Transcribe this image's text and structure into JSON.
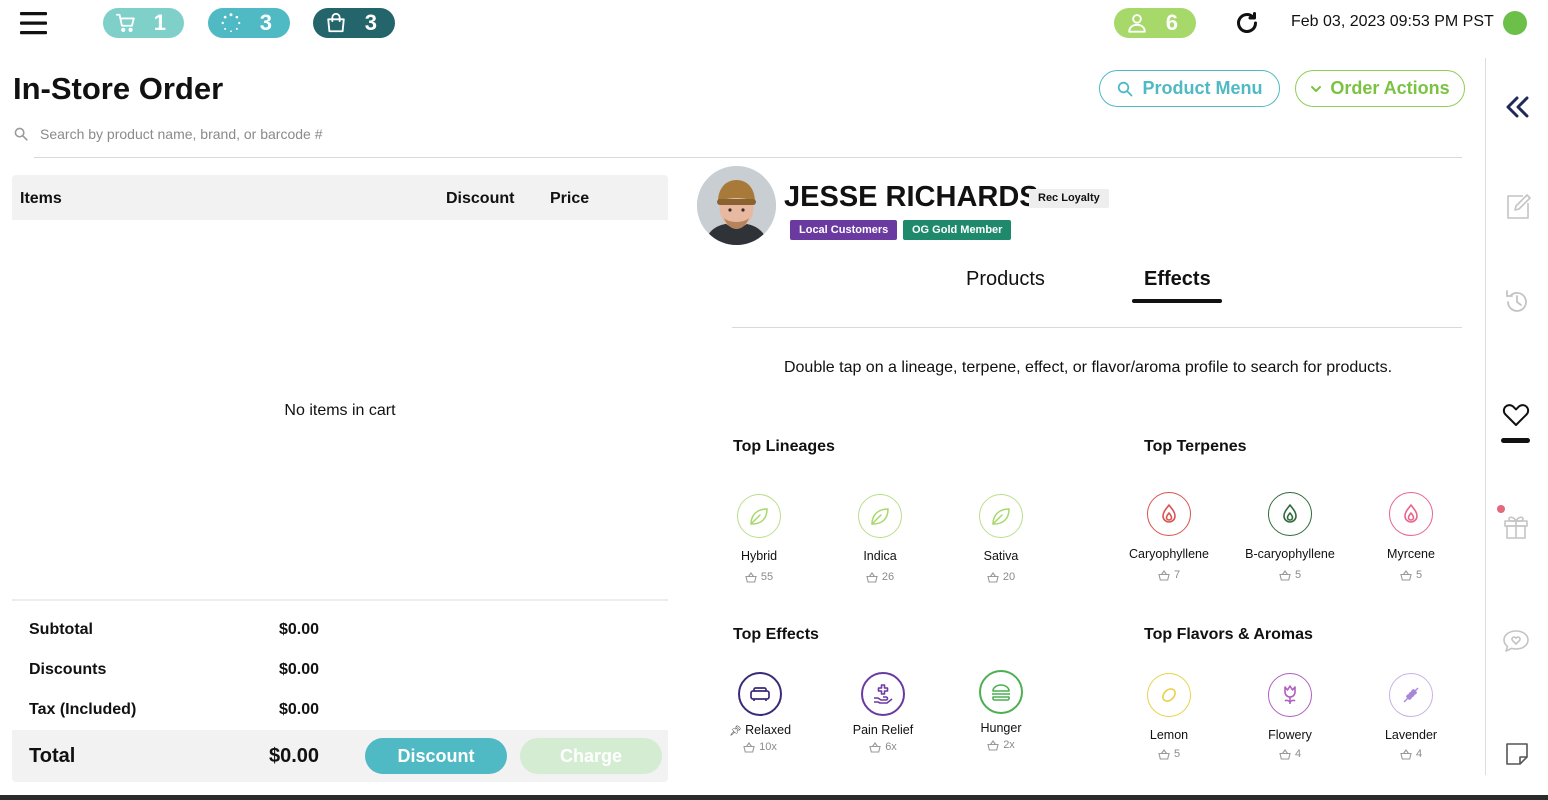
{
  "topbar": {
    "cart_count": "1",
    "pending_count": "3",
    "bag_count": "3",
    "customers_count": "6",
    "datetime": "Feb 03, 2023 09:53 PM PST",
    "colors": {
      "cart": "#7fd0c9",
      "pending": "#4fb9c4",
      "bag": "#23656b",
      "customers": "#a6d96a",
      "status": "#6cc04a"
    }
  },
  "header": {
    "title": "In-Store Order",
    "product_menu_label": "Product Menu",
    "order_actions_label": "Order Actions",
    "search_placeholder": "Search by product name, brand, or barcode #"
  },
  "cart": {
    "columns": {
      "items": "Items",
      "discount": "Discount",
      "price": "Price"
    },
    "empty_message": "No items in cart",
    "summary": [
      {
        "label": "Subtotal",
        "value": "$0.00"
      },
      {
        "label": "Discounts",
        "value": "$0.00"
      },
      {
        "label": "Tax (Included)",
        "value": "$0.00"
      }
    ],
    "total_label": "Total",
    "total_value": "$0.00",
    "discount_label": "Discount",
    "charge_label": "Charge"
  },
  "customer": {
    "name": "JESSE RICHARDS",
    "loyalty_badge": "Rec Loyalty",
    "tags": [
      {
        "label": "Local Customers",
        "color": "#6b3aa0"
      },
      {
        "label": "OG Gold Member",
        "color": "#1f8a6b"
      }
    ]
  },
  "tabs": {
    "products": "Products",
    "effects": "Effects",
    "active": "effects"
  },
  "effects": {
    "instructions": "Double tap on a lineage, terpene, effect, or flavor/aroma profile to search for products.",
    "top_lineages": {
      "title": "Top Lineages",
      "items": [
        {
          "label": "Hybrid",
          "count": "55",
          "icon": "leaf-icon",
          "color": "#a6d96a"
        },
        {
          "label": "Indica",
          "count": "26",
          "icon": "leaf-icon",
          "color": "#a6d96a"
        },
        {
          "label": "Sativa",
          "count": "20",
          "icon": "leaf-icon",
          "color": "#a6d96a"
        }
      ]
    },
    "top_terpenes": {
      "title": "Top Terpenes",
      "items": [
        {
          "label": "Caryophyllene",
          "count": "7",
          "icon": "drop-icon",
          "color": "#d9534f"
        },
        {
          "label": "B-caryophyllene",
          "count": "5",
          "icon": "drop-icon",
          "color": "#2f6b3a"
        },
        {
          "label": "Myrcene",
          "count": "5",
          "icon": "drop-icon",
          "color": "#e9658a"
        }
      ]
    },
    "top_effects": {
      "title": "Top Effects",
      "items": [
        {
          "label": "Relaxed",
          "count": "10x",
          "icon": "couch-icon",
          "color": "#3b2a7a",
          "pinned": "true"
        },
        {
          "label": "Pain Relief",
          "count": "6x",
          "icon": "hand-cross-icon",
          "color": "#6b3aa0"
        },
        {
          "label": "Hunger",
          "count": "2x",
          "icon": "burger-icon",
          "color": "#4caf50"
        }
      ]
    },
    "top_flavors": {
      "title": "Top Flavors & Aromas",
      "items": [
        {
          "label": "Lemon",
          "count": "5",
          "icon": "lemon-icon",
          "color": "#e8d24a"
        },
        {
          "label": "Flowery",
          "count": "4",
          "icon": "tulip-icon",
          "color": "#b05ec0"
        },
        {
          "label": "Lavender",
          "count": "4",
          "icon": "lavender-icon",
          "color": "#a886d8"
        }
      ]
    }
  }
}
